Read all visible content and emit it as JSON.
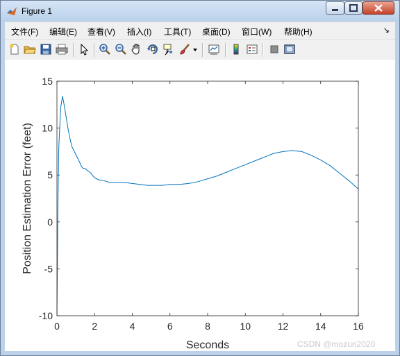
{
  "window": {
    "title": "Figure 1",
    "title_icon": "matlab-icon",
    "caption_buttons": [
      "minimize-icon",
      "maximize-icon",
      "close-icon"
    ]
  },
  "menubar": {
    "items": [
      {
        "label": "文件(F)"
      },
      {
        "label": "编辑(E)"
      },
      {
        "label": "查看(V)"
      },
      {
        "label": "插入(I)"
      },
      {
        "label": "工具(T)"
      },
      {
        "label": "桌面(D)"
      },
      {
        "label": "窗口(W)"
      },
      {
        "label": "帮助(H)"
      }
    ],
    "dock_icon": "dock-arrow-icon"
  },
  "toolbar": {
    "icons": [
      "new-figure-icon",
      "open-file-icon",
      "save-icon",
      "print-icon",
      "edit-plot-arrow-icon",
      "zoom-in-icon",
      "zoom-out-icon",
      "pan-hand-icon",
      "rotate-3d-icon",
      "data-cursor-icon",
      "brush-icon",
      "brush-dropdown-icon",
      "link-plot-icon",
      "insert-colorbar-icon",
      "insert-legend-icon",
      "hide-plot-tools-icon",
      "show-plot-tools-icon"
    ]
  },
  "watermark": "CSDN @mozun2020",
  "colors": {
    "line": "#0072bd",
    "axes": "#262626",
    "window_frame": "#bcd2ea"
  },
  "chart_data": {
    "type": "line",
    "title": "",
    "xlabel": "Seconds",
    "ylabel": "Position Estimation Error (feet)",
    "xlim": [
      0,
      16
    ],
    "ylim": [
      -10,
      15
    ],
    "xticks": [
      "0",
      "2",
      "4",
      "6",
      "8",
      "10",
      "12",
      "14",
      "16"
    ],
    "yticks": [
      "-10",
      "-5",
      "0",
      "5",
      "10",
      "15"
    ],
    "grid": false,
    "series": [
      {
        "x": [
          0,
          0.05,
          0.1,
          0.2,
          0.3,
          0.4,
          0.5,
          0.6,
          0.7,
          0.8,
          0.9,
          1.0,
          1.1,
          1.2,
          1.3,
          1.4,
          1.5,
          1.6,
          1.8,
          2.0,
          2.2,
          2.5,
          2.8,
          3.0,
          3.3,
          3.6,
          4.0,
          4.4,
          4.8,
          5.2,
          5.6,
          6.0,
          6.5,
          7.0,
          7.5,
          8.0,
          8.5,
          9.0,
          9.5,
          10.0,
          10.5,
          11.0,
          11.5,
          12.0,
          12.5,
          13.0,
          13.5,
          14.0,
          14.5,
          15.0,
          15.5,
          16.0
        ],
        "y": [
          -10,
          2,
          8,
          12.2,
          13.4,
          12.3,
          11.0,
          9.8,
          8.8,
          8.0,
          7.6,
          7.2,
          6.8,
          6.4,
          5.9,
          5.7,
          5.7,
          5.5,
          5.2,
          4.7,
          4.5,
          4.4,
          4.2,
          4.2,
          4.2,
          4.2,
          4.1,
          4.0,
          3.9,
          3.9,
          3.9,
          4.0,
          4.0,
          4.1,
          4.3,
          4.6,
          4.9,
          5.3,
          5.7,
          6.1,
          6.5,
          6.9,
          7.3,
          7.5,
          7.6,
          7.5,
          7.1,
          6.6,
          6.0,
          5.2,
          4.4,
          3.5
        ]
      }
    ]
  }
}
